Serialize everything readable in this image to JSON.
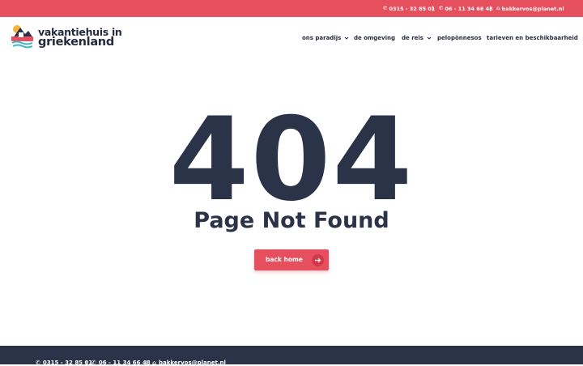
{
  "topbar": {
    "phone1": "0315 - 32 85 01",
    "phone2": "06 - 11 34 66 48",
    "email": "bakkervos@planet.nl",
    "phone_icon": "phone-icon",
    "email_icon": "home-icon"
  },
  "header": {
    "logo_line1": "vakantiehuis in",
    "logo_line2": "griekenland",
    "nav": [
      {
        "label": "ons paradijs",
        "has_dropdown": true
      },
      {
        "label": "de omgeving",
        "has_dropdown": false
      },
      {
        "label": "de reis",
        "has_dropdown": true
      },
      {
        "label": "pelopònnesos",
        "has_dropdown": false
      },
      {
        "label": "tarieven en beschikbaarheid",
        "has_dropdown": false
      }
    ]
  },
  "main": {
    "error_code": "404",
    "message": "Page Not Found",
    "back_button": "back home",
    "arrow_icon": "arrow-right-icon"
  },
  "footer": {
    "phone1": "0315 - 32 85 01",
    "phone2": "06 - 11 34 66 48",
    "email": "bakkervos@planet.nl"
  },
  "colors": {
    "accent": "#e6505e",
    "dark": "#2b3349",
    "text": "#232a3d"
  }
}
